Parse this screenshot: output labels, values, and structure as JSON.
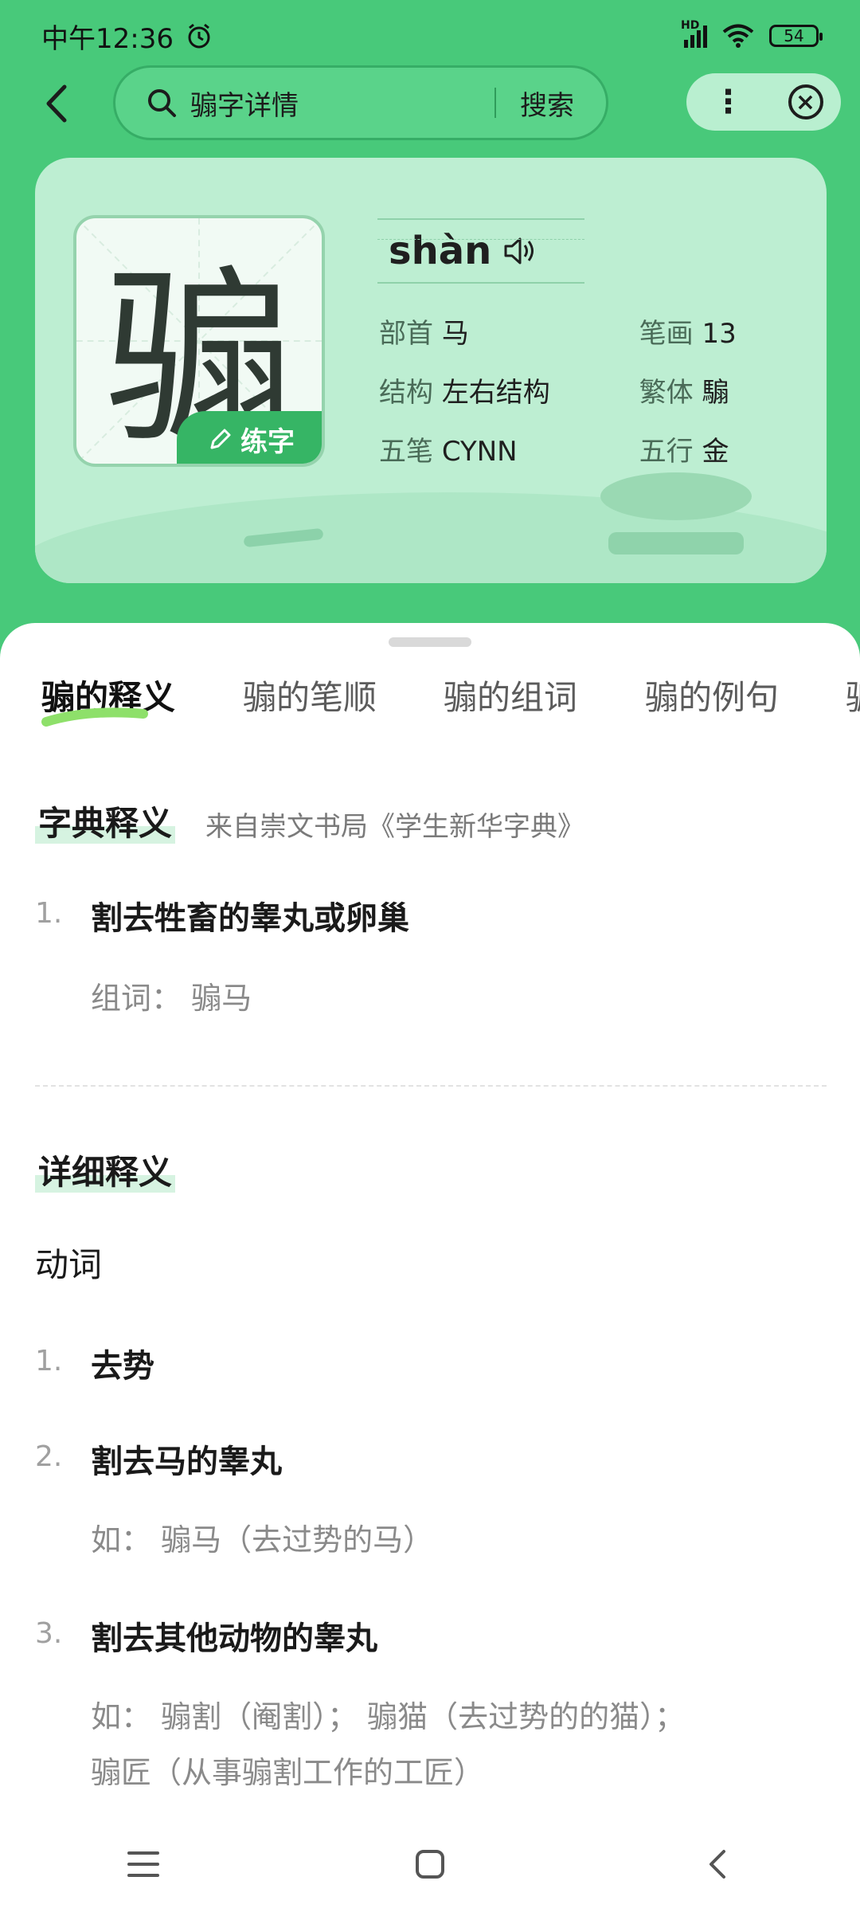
{
  "status_bar": {
    "time": "中午12:36",
    "network": "HD",
    "battery": "54"
  },
  "search": {
    "query": "骟字详情",
    "search_button": "搜索"
  },
  "character": {
    "glyph": "骟",
    "practice_label": "练字",
    "pinyin": "shàn",
    "info": [
      [
        {
          "label": "部首",
          "value": "马"
        },
        {
          "label": "笔画",
          "value": "13"
        }
      ],
      [
        {
          "label": "结构",
          "value": "左右结构"
        },
        {
          "label": "繁体",
          "value": "騸"
        }
      ],
      [
        {
          "label": "五笔",
          "value": "CYNN"
        },
        {
          "label": "五行",
          "value": "金"
        }
      ]
    ]
  },
  "tabs": [
    "骟的释义",
    "骟的笔顺",
    "骟的组词",
    "骟的例句",
    "骟"
  ],
  "dict_section": {
    "title": "字典释义",
    "source": "来自崇文书局《学生新华字典》",
    "definitions": [
      {
        "num": "1.",
        "text": "割去牲畜的睾丸或卵巢",
        "sub": "组词：  骟马"
      }
    ]
  },
  "detail_section": {
    "title": "详细释义",
    "pos": "动词",
    "definitions": [
      {
        "num": "1.",
        "text": "去势"
      },
      {
        "num": "2.",
        "text": "割去马的睾丸",
        "sub": "如：  骟马（去过势的马）"
      },
      {
        "num": "3.",
        "text": "割去其他动物的睾丸",
        "sub": "如：  骟割（阉割）；  骟猫（去过势的的猫）；",
        "sub2": "骟匠（从事骟割工作的工匠）"
      }
    ]
  },
  "icons": [
    "alarm-icon",
    "signal-icon",
    "wifi-icon",
    "battery-icon",
    "back-icon",
    "search-icon",
    "more-icon",
    "close-icon",
    "pencil-icon",
    "speaker-icon",
    "menu-icon",
    "home-icon",
    "back-nav-icon"
  ],
  "colors": {
    "brand_green": "#48c97a",
    "card_bg": "#bdeed2",
    "practice_green": "#36b565"
  }
}
